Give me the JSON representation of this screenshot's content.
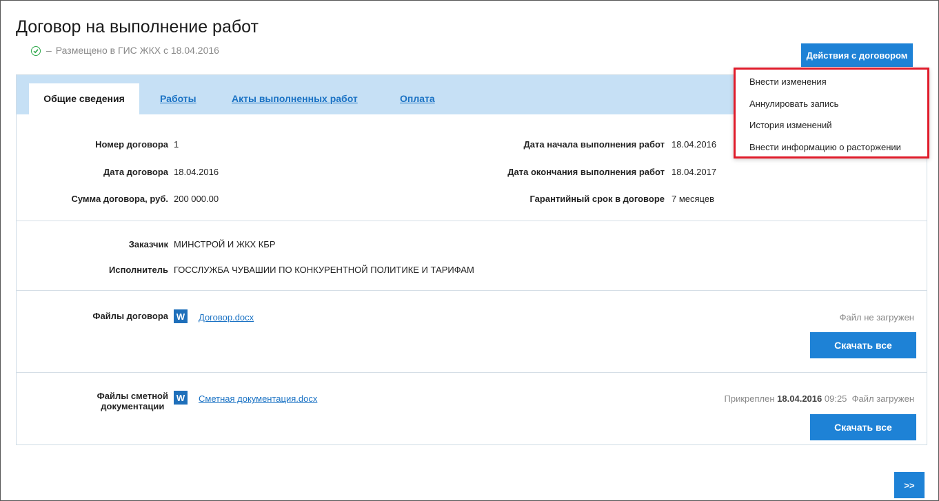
{
  "page": {
    "title": "Договор на выполнение работ",
    "status_dash": "–",
    "status_text": "Размещено в ГИС ЖКХ с 18.04.2016"
  },
  "actions": {
    "button_label": "Действия с договором",
    "menu": [
      "Внести изменения",
      "Аннулировать запись",
      "История изменений",
      "Внести информацию о расторжении"
    ]
  },
  "tabs": [
    "Общие сведения",
    "Работы",
    "Акты выполненных работ",
    "Оплата"
  ],
  "details": {
    "contract_number_label": "Номер договора",
    "contract_number": "1",
    "contract_date_label": "Дата договора",
    "contract_date": "18.04.2016",
    "contract_sum_label": "Сумма договора, руб.",
    "contract_sum": "200 000.00",
    "start_date_label": "Дата начала выполнения работ",
    "start_date": "18.04.2016",
    "end_date_label": "Дата окончания выполнения работ",
    "end_date": "18.04.2017",
    "warranty_label": "Гарантийный срок в договоре",
    "warranty": "7 месяцев"
  },
  "parties": {
    "customer_label": "Заказчик",
    "customer": "МИНСТРОЙ И ЖКХ КБР",
    "contractor_label": "Исполнитель",
    "contractor": "ГОССЛУЖБА ЧУВАШИИ ПО КОНКУРЕНТНОЙ ПОЛИТИКЕ И ТАРИФАМ"
  },
  "contract_files": {
    "label": "Файлы договора",
    "file_name": "Договор.docx",
    "file_icon": "W",
    "status": "Файл не загружен",
    "download_label": "Скачать все"
  },
  "estimate_files": {
    "label_line1": "Файлы сметной",
    "label_line2": "документации",
    "file_name": "Сметная документация.docx",
    "file_icon": "W",
    "attached_prefix": "Прикреплен",
    "attached_date": "18.04.2016",
    "attached_time": "09:25",
    "status": "Файл загружен",
    "download_label": "Скачать все"
  },
  "next_label": ">>",
  "colors": {
    "accent": "#1e82d6",
    "tabbar": "#c6e0f5",
    "link": "#1a72c4",
    "highlight_border": "#e01b2a",
    "status_ok": "#2ea84a"
  }
}
